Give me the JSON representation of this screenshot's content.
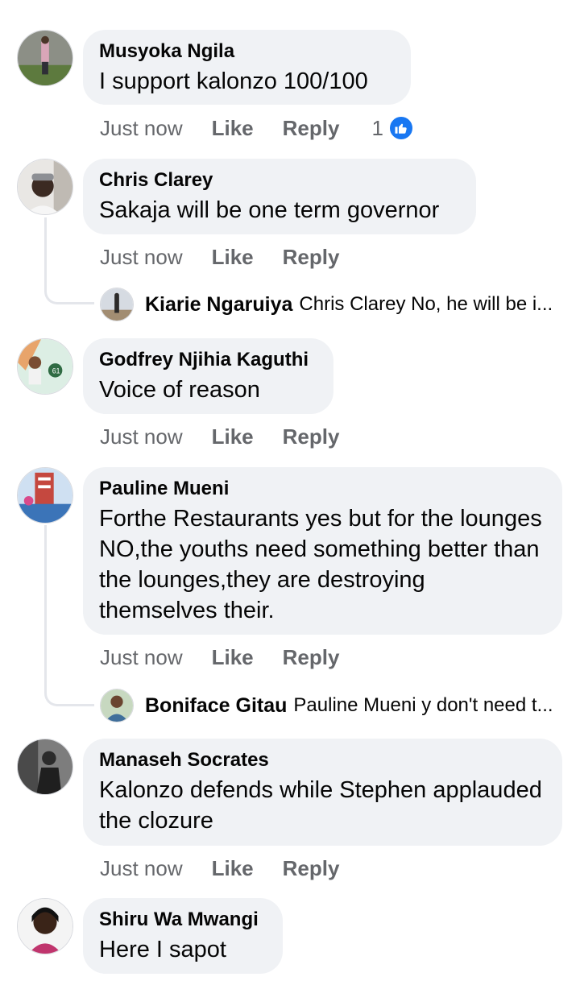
{
  "comments": [
    {
      "author": "Musyoka Ngila",
      "text": "I support kalonzo 100/100",
      "actions": {
        "time": "Just now",
        "like": "Like",
        "reply": "Reply"
      },
      "reactions": {
        "count": "1",
        "icon": "like-icon",
        "color": "#1877f2"
      }
    },
    {
      "author": "Chris Clarey",
      "text": "Sakaja will be one term governor",
      "actions": {
        "time": "Just now",
        "like": "Like",
        "reply": "Reply"
      },
      "reply_preview": {
        "author": "Kiarie Ngaruiya",
        "text": "Chris Clarey No, he will be i..."
      }
    },
    {
      "author": "Godfrey Njihia Kaguthi",
      "text": "Voice of reason",
      "actions": {
        "time": "Just now",
        "like": "Like",
        "reply": "Reply"
      }
    },
    {
      "author": "Pauline Mueni",
      "text": "Forthe Restaurants yes but for the lounges NO,the youths need something better than the lounges,they are destroying themselves their.",
      "actions": {
        "time": "Just now",
        "like": "Like",
        "reply": "Reply"
      },
      "reply_preview": {
        "author": "Boniface Gitau",
        "text": "Pauline Mueni y don't need t..."
      }
    },
    {
      "author": "Manaseh Socrates",
      "text": "Kalonzo defends while Stephen applauded the clozure",
      "actions": {
        "time": "Just now",
        "like": "Like",
        "reply": "Reply"
      }
    },
    {
      "author": "Shiru Wa Mwangi",
      "text": "Here I sapot"
    }
  ],
  "colors": {
    "bubble": "#f0f2f5",
    "secondary_text": "#65676b",
    "like_blue": "#1877f2"
  }
}
